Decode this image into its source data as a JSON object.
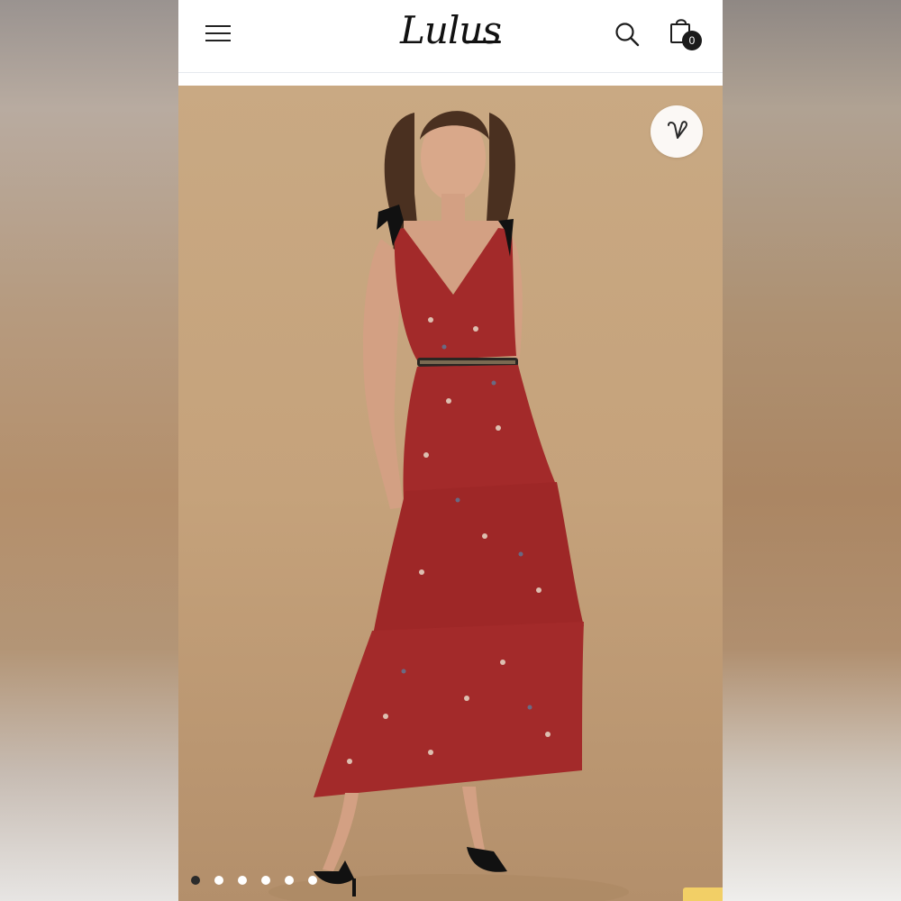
{
  "header": {
    "logo_text": "Lulus",
    "cart_count": "0",
    "icons": {
      "menu": "hamburger-menu-icon",
      "search": "search-icon",
      "bag": "shopping-bag-icon"
    }
  },
  "product_image": {
    "wishlist_icon": "heart-icon",
    "carousel": {
      "total_slides": 6,
      "active_index": 0
    }
  },
  "colors": {
    "background_beige": "#c5a27b",
    "dress_red": "#a32a2a",
    "accent_black": "#1b1b1b",
    "yellow_accent": "#f2cf66"
  }
}
